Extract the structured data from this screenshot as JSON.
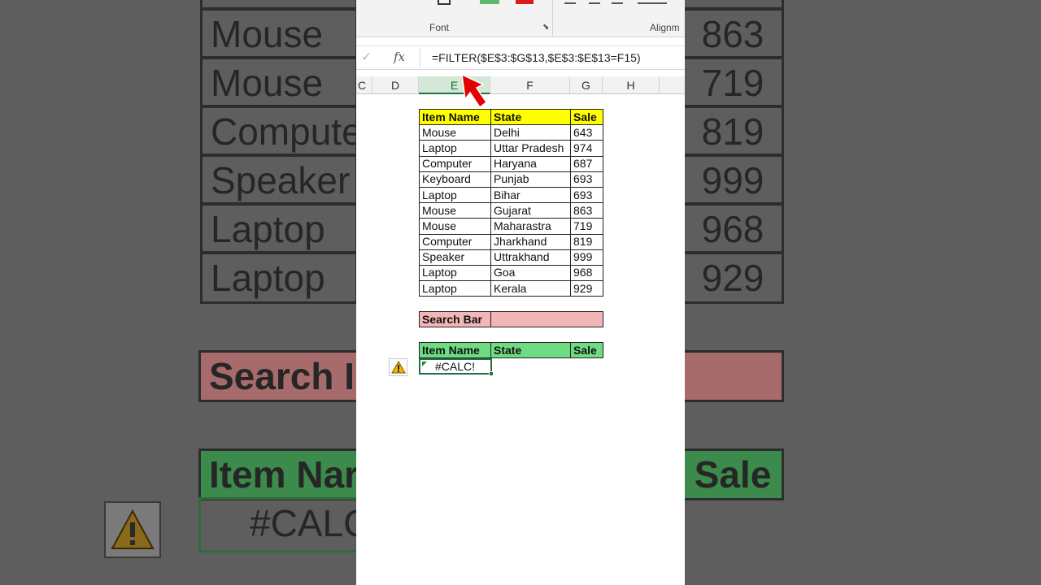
{
  "ribbon": {
    "font_group": "Font",
    "alignment_group": "Alignm"
  },
  "formula_bar": {
    "fx": "fx",
    "formula": "=FILTER($E$3:$G$13,$E$3:$E$13=F15)"
  },
  "columns": [
    "C",
    "D",
    "E",
    "F",
    "G",
    "H"
  ],
  "source_table": {
    "headers": [
      "Item Name",
      "State",
      "Sale"
    ],
    "rows": [
      [
        "Mouse",
        "Delhi",
        "643"
      ],
      [
        "Laptop",
        "Uttar Pradesh",
        "974"
      ],
      [
        "Computer",
        "Haryana",
        "687"
      ],
      [
        "Keyboard",
        "Punjab",
        "693"
      ],
      [
        "Laptop",
        "Bihar",
        "693"
      ],
      [
        "Mouse",
        "Gujarat",
        "863"
      ],
      [
        "Mouse",
        "Maharastra",
        "719"
      ],
      [
        "Computer",
        "Jharkhand",
        "819"
      ],
      [
        "Speaker",
        "Uttrakhand",
        "999"
      ],
      [
        "Laptop",
        "Goa",
        "968"
      ],
      [
        "Laptop",
        "Kerala",
        "929"
      ]
    ]
  },
  "search": {
    "label": "Search Bar",
    "value": ""
  },
  "result_table": {
    "headers": [
      "Item Name",
      "State",
      "Sale"
    ],
    "error": "#CALC!"
  },
  "background_zoom": {
    "items": [
      "Mouse",
      "Mouse",
      "Compute",
      "Speaker",
      "Laptop",
      "Laptop"
    ],
    "sales": [
      "863",
      "719",
      "819",
      "999",
      "968",
      "929"
    ],
    "search_label": "Search I",
    "item_header": "Item Nar",
    "sale_header": "Sale",
    "error": "#CALC"
  },
  "colors": {
    "header_yellow": "#ffff00",
    "header_green": "#6fdc84",
    "search_pink": "#f2b6b6",
    "excel_green": "#217346",
    "arrow_red": "#e30000"
  }
}
